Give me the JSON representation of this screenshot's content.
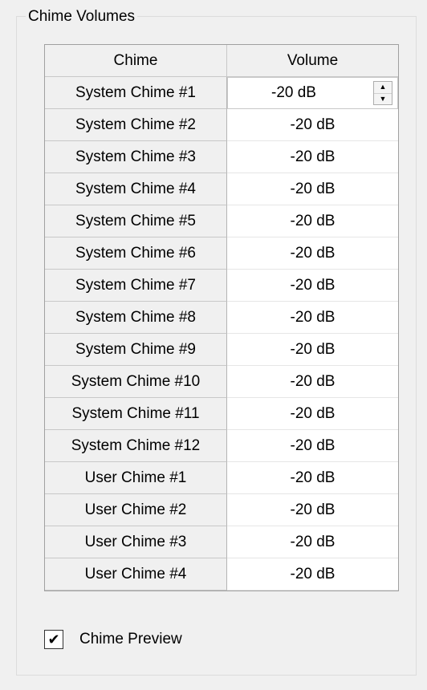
{
  "group": {
    "title": "Chime Volumes"
  },
  "grid": {
    "headers": {
      "chime": "Chime",
      "volume": "Volume"
    },
    "rows": [
      {
        "chime": "System Chime #1",
        "volume": "-20 dB"
      },
      {
        "chime": "System Chime #2",
        "volume": "-20 dB"
      },
      {
        "chime": "System Chime #3",
        "volume": "-20 dB"
      },
      {
        "chime": "System Chime #4",
        "volume": "-20 dB"
      },
      {
        "chime": "System Chime #5",
        "volume": "-20 dB"
      },
      {
        "chime": "System Chime #6",
        "volume": "-20 dB"
      },
      {
        "chime": "System Chime #7",
        "volume": "-20 dB"
      },
      {
        "chime": "System Chime #8",
        "volume": "-20 dB"
      },
      {
        "chime": "System Chime #9",
        "volume": "-20 dB"
      },
      {
        "chime": "System Chime #10",
        "volume": "-20 dB"
      },
      {
        "chime": "System Chime #11",
        "volume": "-20 dB"
      },
      {
        "chime": "System Chime #12",
        "volume": "-20 dB"
      },
      {
        "chime": "User Chime #1",
        "volume": "-20 dB"
      },
      {
        "chime": "User Chime #2",
        "volume": "-20 dB"
      },
      {
        "chime": "User Chime #3",
        "volume": "-20 dB"
      },
      {
        "chime": "User Chime #4",
        "volume": "-20 dB"
      }
    ],
    "spinner": {
      "up_icon": "spin-up-icon",
      "down_icon": "spin-down-icon"
    }
  },
  "chime_preview": {
    "label": "Chime Preview",
    "checked": true
  }
}
